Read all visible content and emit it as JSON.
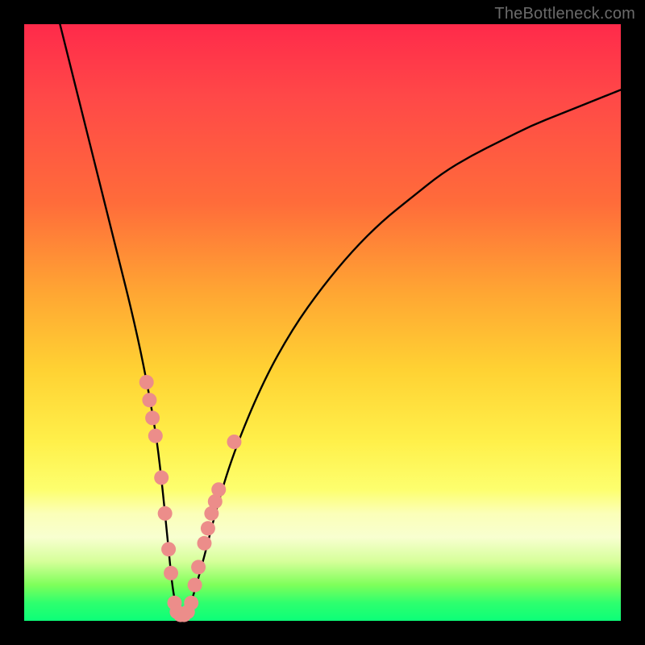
{
  "watermark": "TheBottleneck.com",
  "chart_data": {
    "type": "line",
    "title": "",
    "xlabel": "",
    "ylabel": "",
    "xlim": [
      0,
      100
    ],
    "ylim": [
      0,
      100
    ],
    "series": [
      {
        "name": "bottleneck-curve",
        "x": [
          6,
          8,
          10,
          12,
          14,
          16,
          18,
          20,
          22,
          23,
          24,
          25,
          26,
          27,
          28,
          30,
          32,
          35,
          40,
          45,
          50,
          55,
          60,
          65,
          70,
          75,
          80,
          85,
          90,
          95,
          100
        ],
        "values": [
          100,
          92,
          84,
          76,
          68,
          60,
          52,
          43,
          32,
          24,
          14,
          4,
          1,
          1,
          3,
          10,
          18,
          28,
          40,
          49,
          56,
          62,
          67,
          71,
          75,
          78,
          80.5,
          83,
          85,
          87,
          89
        ]
      }
    ],
    "markers": {
      "name": "highlighted-points",
      "color": "#ec8d8a",
      "points": [
        {
          "x": 20.5,
          "y": 40
        },
        {
          "x": 21.0,
          "y": 37
        },
        {
          "x": 21.5,
          "y": 34
        },
        {
          "x": 22.0,
          "y": 31
        },
        {
          "x": 23.0,
          "y": 24
        },
        {
          "x": 23.6,
          "y": 18
        },
        {
          "x": 24.2,
          "y": 12
        },
        {
          "x": 24.6,
          "y": 8
        },
        {
          "x": 25.2,
          "y": 3
        },
        {
          "x": 25.6,
          "y": 1.5
        },
        {
          "x": 26.2,
          "y": 1
        },
        {
          "x": 26.8,
          "y": 1
        },
        {
          "x": 27.4,
          "y": 1.5
        },
        {
          "x": 28.0,
          "y": 3
        },
        {
          "x": 28.6,
          "y": 6
        },
        {
          "x": 29.2,
          "y": 9
        },
        {
          "x": 30.2,
          "y": 13
        },
        {
          "x": 30.8,
          "y": 15.5
        },
        {
          "x": 31.4,
          "y": 18
        },
        {
          "x": 32.0,
          "y": 20
        },
        {
          "x": 32.6,
          "y": 22
        },
        {
          "x": 35.2,
          "y": 30
        }
      ]
    }
  }
}
